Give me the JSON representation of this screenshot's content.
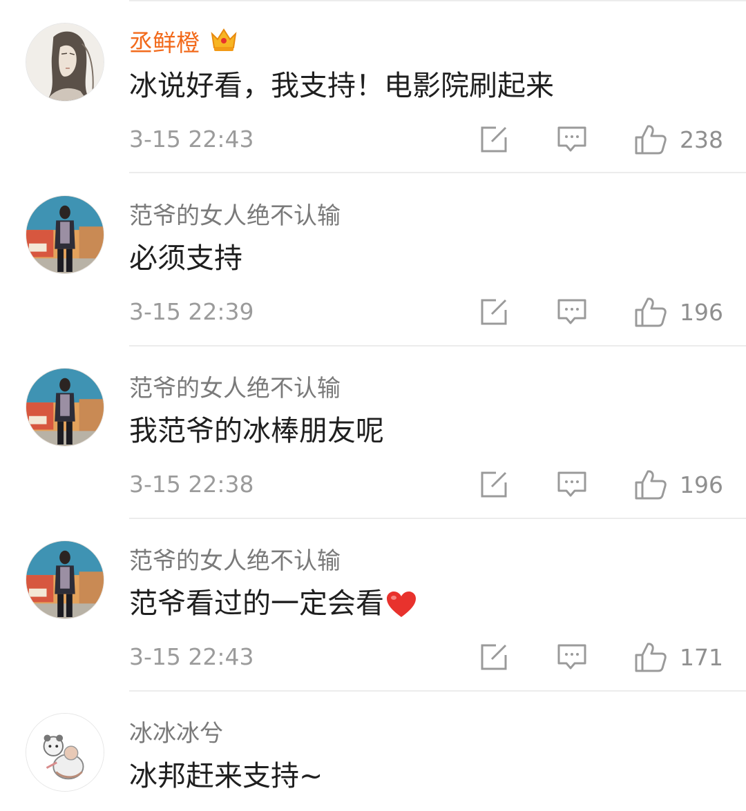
{
  "comments": [
    {
      "username": "丞鲜橙",
      "vip": true,
      "badge_icon": "crown-badge-icon",
      "text": "冰说好看，我支持！电影院刷起来",
      "time": "3-15 22:43",
      "likes": "238",
      "avatar": "illustrated-portrait"
    },
    {
      "username": "范爷的女人绝不认输",
      "vip": false,
      "text": "必须支持",
      "time": "3-15 22:39",
      "likes": "196",
      "avatar": "standing-person-photo"
    },
    {
      "username": "范爷的女人绝不认输",
      "vip": false,
      "text": "我范爷的冰棒朋友呢",
      "time": "3-15 22:38",
      "likes": "196",
      "avatar": "standing-person-photo"
    },
    {
      "username": "范爷的女人绝不认输",
      "vip": false,
      "text": "范爷看过的一定会看",
      "emoji": "heart-emoji",
      "time": "3-15 22:43",
      "likes": "171",
      "avatar": "standing-person-photo"
    },
    {
      "username": "冰冰冰兮",
      "vip": false,
      "text": "冰邦赶来支持~",
      "avatar": "cartoon-bear-drawing"
    }
  ],
  "icons": {
    "repost": "edit-share-icon",
    "comment": "comment-bubble-icon",
    "like": "thumbs-up-icon"
  },
  "colors": {
    "vip_name": "#f26a1b",
    "name": "#7a7a7a",
    "text": "#1f1f1f",
    "meta": "#9b9b9b",
    "divider": "#ececec",
    "heart": "#e8322d"
  }
}
